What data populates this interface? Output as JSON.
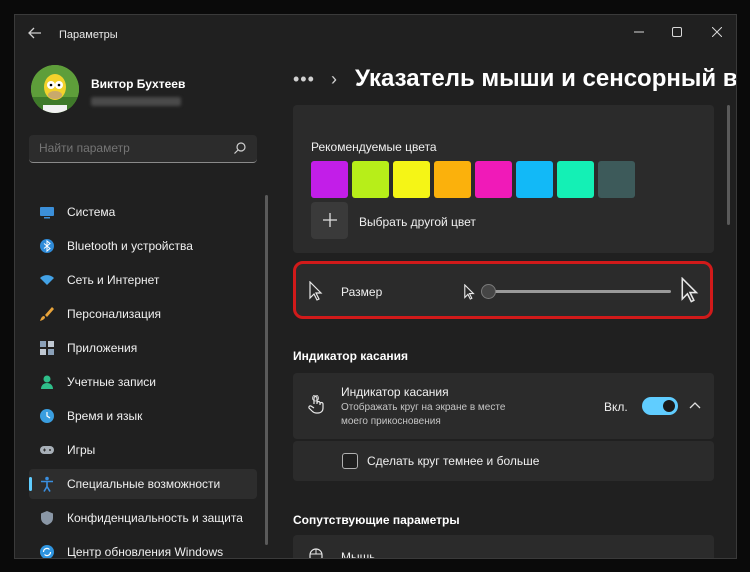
{
  "window": {
    "title": "Параметры",
    "back_icon": "arrow-left-icon",
    "controls": [
      "minimize",
      "maximize",
      "close"
    ]
  },
  "user": {
    "name": "Виктор Бухтеев",
    "email": ""
  },
  "search": {
    "placeholder": "Найти параметр",
    "icon": "search-icon"
  },
  "sidebar": {
    "items": [
      {
        "label": "Система",
        "icon": "monitor-icon",
        "color": "#3b8fd9"
      },
      {
        "label": "Bluetooth и устройства",
        "icon": "bluetooth-icon",
        "color": "#2f8bd8"
      },
      {
        "label": "Сеть и Интернет",
        "icon": "wifi-icon",
        "color": "#43a2e6"
      },
      {
        "label": "Персонализация",
        "icon": "brush-icon",
        "color": "#e8a33a"
      },
      {
        "label": "Приложения",
        "icon": "apps-icon",
        "color": "#8aa0b8"
      },
      {
        "label": "Учетные записи",
        "icon": "person-icon",
        "color": "#2fbf8a"
      },
      {
        "label": "Время и язык",
        "icon": "globe-clock-icon",
        "color": "#3a9ee0"
      },
      {
        "label": "Игры",
        "icon": "gamepad-icon",
        "color": "#a8b0b8"
      },
      {
        "label": "Специальные возможности",
        "icon": "accessibility-icon",
        "color": "#3a8fe0",
        "active": true
      },
      {
        "label": "Конфиденциальность и защита",
        "icon": "shield-icon",
        "color": "#8a97a6"
      },
      {
        "label": "Центр обновления Windows",
        "icon": "update-icon",
        "color": "#2f95e0"
      }
    ]
  },
  "breadcrumb": {
    "dots": "•••",
    "chevron": "›",
    "title": "Указатель мыши и сенсорный ввод"
  },
  "colors_section": {
    "label": "Рекомендуемые цвета",
    "swatches": [
      "#c21ee8",
      "#b7ee19",
      "#f5f516",
      "#fbb10c",
      "#f01ab8",
      "#12b9f7",
      "#14f0b5",
      "#3d5a5a"
    ],
    "pick_other_label": "Выбрать другой цвет"
  },
  "size_row": {
    "label": "Размер",
    "value_fraction": 0.0,
    "icon": "pointer-icon"
  },
  "touch_section": {
    "heading": "Индикатор касания",
    "title": "Индикатор касания",
    "description_line1": "Отображать круг на экране в месте",
    "description_line2": "моего прикосновения",
    "toggle_label": "Вкл.",
    "toggle_on": true,
    "checkbox_label": "Сделать круг темнее и больше",
    "checkbox_checked": false
  },
  "related_section": {
    "heading": "Сопутствующие параметры",
    "first_item": "Мышь"
  }
}
